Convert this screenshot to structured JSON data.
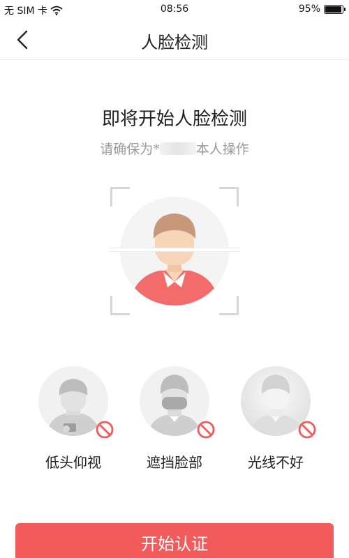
{
  "status_bar": {
    "carrier": "无 SIM 卡",
    "time": "08:56",
    "battery": "95%",
    "battery_level": 0.95,
    "icons": [
      "wifi-icon",
      "battery-icon"
    ]
  },
  "nav": {
    "title": "人脸检测",
    "back_icon": "chevron-left-icon"
  },
  "content": {
    "title": "即将开始人脸检测",
    "subtitle_prefix": "请确保为*",
    "subtitle_suffix": "本人操作"
  },
  "tips": [
    {
      "label": "低头仰视",
      "icon": "looking-down-icon"
    },
    {
      "label": "遮挡脸部",
      "icon": "face-covered-icon"
    },
    {
      "label": "光线不好",
      "icon": "poor-lighting-icon"
    }
  ],
  "button": {
    "label": "开始认证"
  },
  "colors": {
    "accent": "#f35a5a",
    "skin": "#f6d5b9",
    "hair": "#c7987a"
  }
}
